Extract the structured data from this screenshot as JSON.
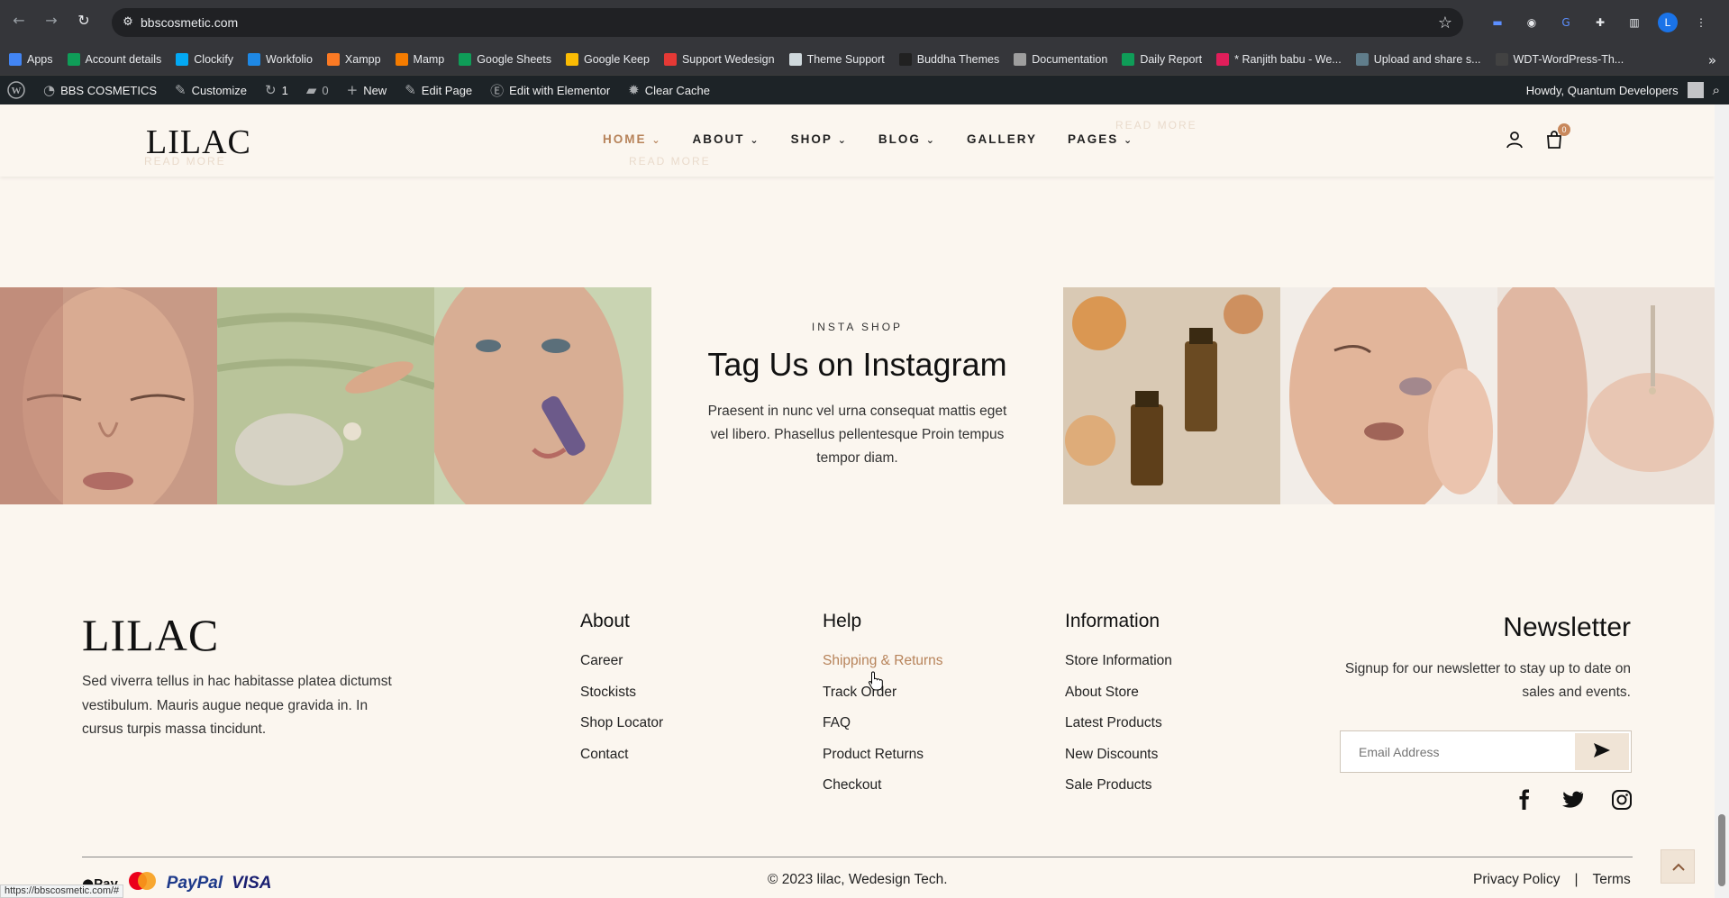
{
  "browser": {
    "url": "bbscosmetic.com",
    "profile_initial": "L",
    "status_url": "https://bbscosmetic.com/#",
    "bookmarks": [
      {
        "label": "Apps",
        "color": "#4285f4"
      },
      {
        "label": "Account details",
        "color": "#0f9d58"
      },
      {
        "label": "Clockify",
        "color": "#03a9f4"
      },
      {
        "label": "Workfolio",
        "color": "#1e88e5"
      },
      {
        "label": "Xampp",
        "color": "#fb7a24"
      },
      {
        "label": "Mamp",
        "color": "#f57c00"
      },
      {
        "label": "Google Sheets",
        "color": "#0f9d58"
      },
      {
        "label": "Google Keep",
        "color": "#fbbc04"
      },
      {
        "label": "Support Wedesign",
        "color": "#e53935"
      },
      {
        "label": "Theme Support",
        "color": "#cfd8dc"
      },
      {
        "label": "Buddha Themes",
        "color": "#212121"
      },
      {
        "label": "Documentation",
        "color": "#9e9e9e"
      },
      {
        "label": "Daily Report",
        "color": "#0f9d58"
      },
      {
        "label": "* Ranjith babu - We...",
        "color": "#e01e5a"
      },
      {
        "label": "Upload and share s...",
        "color": "#607d8b"
      },
      {
        "label": "WDT-WordPress-Th...",
        "color": "#424242"
      }
    ]
  },
  "adminbar": {
    "site_name": "BBS COSMETICS",
    "customize": "Customize",
    "updates_count": "1",
    "comments_count": "0",
    "new": "New",
    "edit_page": "Edit Page",
    "edit_elementor": "Edit with Elementor",
    "clear_cache": "Clear Cache",
    "howdy": "Howdy, Quantum Developers"
  },
  "header": {
    "logo": "LILAC",
    "nav": [
      {
        "label": "HOME",
        "dropdown": true,
        "active": true
      },
      {
        "label": "ABOUT",
        "dropdown": true,
        "active": false
      },
      {
        "label": "SHOP",
        "dropdown": true,
        "active": false
      },
      {
        "label": "BLOG",
        "dropdown": true,
        "active": false
      },
      {
        "label": "GALLERY",
        "dropdown": false,
        "active": false
      },
      {
        "label": "PAGES",
        "dropdown": true,
        "active": false
      }
    ],
    "cart_count": "0",
    "ghost_read_more": "READ MORE"
  },
  "insta": {
    "eyebrow": "INSTA SHOP",
    "title": "Tag Us on Instagram",
    "text": "Praesent in nunc vel urna consequat mattis eget vel libero. Phasellus pellentesque Proin tempus tempor diam.",
    "tiles": [
      {
        "icon": "face-closed-eyes-photo",
        "bg": "#c89a86"
      },
      {
        "icon": "green-clay-photo",
        "bg": "#b9c49a"
      },
      {
        "icon": "face-roller-photo",
        "bg": "#d6b39a"
      },
      {
        "icon": "serum-bottles-photo",
        "bg": "#d9c9b4"
      },
      {
        "icon": "face-hand-photo",
        "bg": "#e2bfa8"
      },
      {
        "icon": "hand-dropper-photo",
        "bg": "#e8d7cc"
      }
    ]
  },
  "footer": {
    "logo": "LILAC",
    "description": "Sed viverra tellus in hac habitasse platea dictumst vestibulum. Mauris augue neque gravida in. In cursus turpis massa tincidunt.",
    "columns": [
      {
        "title": "About",
        "links": [
          "Career",
          "Stockists",
          "Shop Locator",
          "Contact"
        ]
      },
      {
        "title": "Help",
        "links": [
          "Shipping & Returns",
          "Track Order",
          "FAQ",
          "Product Returns",
          "Checkout"
        ]
      },
      {
        "title": "Information",
        "links": [
          "Store Information",
          "About Store",
          "Latest Products",
          "New Discounts",
          "Sale Products"
        ]
      }
    ],
    "newsletter": {
      "title": "Newsletter",
      "text": "Signup for our newsletter to stay up to date on sales and events.",
      "placeholder": "Email Address"
    },
    "payments": {
      "apple": "Pay",
      "paypal": "PayPal",
      "visa": "VISA"
    },
    "copyright": "© 2023 lilac, Wedesign Tech.",
    "privacy": "Privacy Policy",
    "separator": "|",
    "terms": "Terms"
  },
  "colors": {
    "accent": "#b7835a",
    "background": "#fbf6ef",
    "adminbar": "#1d2327"
  }
}
